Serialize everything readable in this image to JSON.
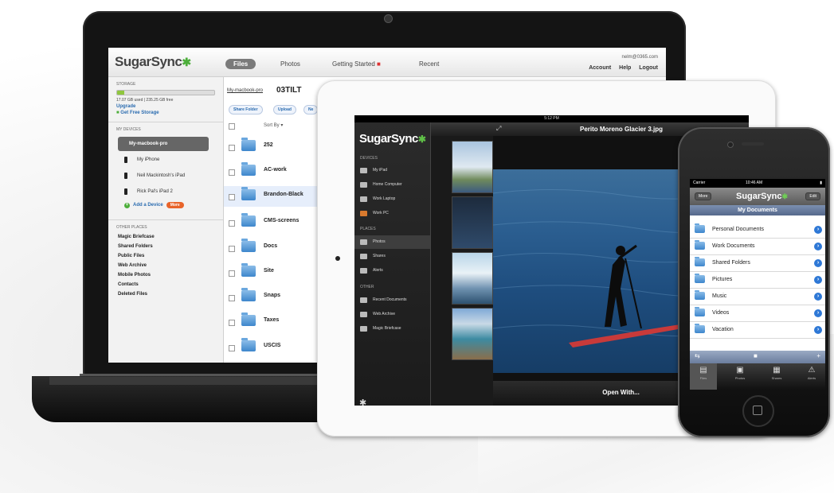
{
  "laptop": {
    "app_logo": "SugarSync",
    "nav_tabs": [
      "Files",
      "Photos",
      "Getting Started",
      "Recent"
    ],
    "user_email": "nelm@0365.com",
    "user_links": [
      "Account",
      "Help",
      "Logout"
    ],
    "storage": {
      "heading": "STORAGE",
      "usage_text": "17.07 GB used | 235.25 GB free",
      "used_fraction": 0.07,
      "upgrade_label": "Upgrade",
      "get_free_label": "Get Free Storage"
    },
    "devices": {
      "heading": "MY DEVICES",
      "items": [
        "My-macbook-pro",
        "My iPhone",
        "Neil Mackintosh's iPad",
        "Rick Pal's iPad 2"
      ],
      "add_label": "Add a Device",
      "add_badge": "More"
    },
    "other_places": {
      "heading": "OTHER PLACES",
      "items": [
        "Magic Briefcase",
        "Shared Folders",
        "Public Files",
        "Web Archive",
        "Mobile Photos",
        "Contacts",
        "Deleted Files"
      ]
    },
    "main": {
      "breadcrumb": "My-macbook-pro",
      "title": "03TILT",
      "toolbar": [
        "Share Folder",
        "Upload",
        "Ne"
      ],
      "sort_label": "Sort By ▾",
      "files": [
        "252",
        "AC-work",
        "Brandon-Black",
        "CMS-screens",
        "Docs",
        "Site",
        "Snaps",
        "Taxes",
        "USCIS"
      ]
    }
  },
  "tablet": {
    "status_time": "5:12 PM",
    "app_logo": "SugarSync",
    "photo_title": "Perito Moreno Glacier 3.jpg",
    "sections": [
      {
        "heading": "DEVICES",
        "items": [
          "My iPad",
          "Home Computer",
          "Work Laptop",
          "Work PC"
        ]
      },
      {
        "heading": "PLACES",
        "items": [
          "Photos",
          "Shares",
          "Alerts"
        ]
      },
      {
        "heading": "OTHER",
        "items": [
          "Recent Documents",
          "Web Archive",
          "Magic Briefcase"
        ]
      }
    ],
    "open_with_label": "Open With..."
  },
  "phone": {
    "carrier": "Carrier",
    "time": "10:46 AM",
    "back_button": "More",
    "edit_button": "Edit",
    "app_logo": "SugarSync",
    "title": "My Documents",
    "items": [
      "Personal Documents",
      "Work Documents",
      "Shared Folders",
      "Pictures",
      "Music",
      "Videos",
      "Vacation"
    ],
    "tabs": [
      "Files",
      "Photos",
      "Shares",
      "Alerts"
    ]
  },
  "colors": {
    "brand_green": "#4cae3a",
    "link_blue": "#2b6cb0",
    "accent_orange": "#e8642a"
  }
}
